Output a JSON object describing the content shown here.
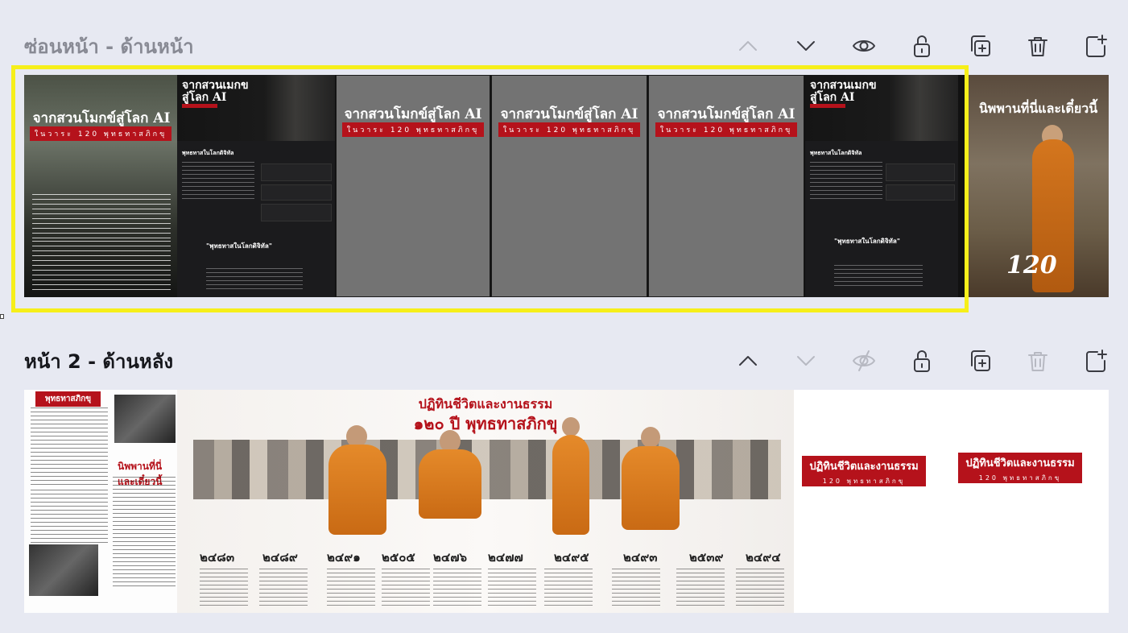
{
  "pages": [
    {
      "title": "ซ่อนหน้า - ด้านหน้า",
      "tools": [
        "chevron-up",
        "chevron-down",
        "eye",
        "lock",
        "duplicate",
        "trash",
        "add-page"
      ]
    },
    {
      "title": "หน้า 2 - ด้านหลัง",
      "tools": [
        "chevron-up",
        "chevron-down",
        "eye-off",
        "lock",
        "duplicate",
        "trash",
        "add-page"
      ]
    }
  ],
  "page1": {
    "poster_title": "จากสวนโมกข์สู่โลก AI",
    "poster_sub": "ในวาระ 120 พุทธทาสภิกขุ",
    "web_title": "จากสวนเมกข\nสู่โลก AI",
    "web_section": "พุทธทาสในโลกดิจิทัล",
    "web_quote": "\"พุทธทาสในโลกดิจิทัล\"",
    "monk_title": "นิพพานที่นี่และเดี๋ยวนี้",
    "monk_number": "120"
  },
  "page2": {
    "doc_tag": "พุทธทาสภิกขุ",
    "doc_title": "นิพพานที่นี่และเดี๋ยวนี้",
    "timeline_title": "ปฏิทินชีวิตและงานธรรม",
    "timeline_subtitle": "๑๒๐ ปี พุทธทาสภิกขุ",
    "years": [
      "๒๔๘๓",
      "๒๔๘๙",
      "๒๔๙๑",
      "๒๕๐๕",
      "๒๔๗๖",
      "๒๔๗๗",
      "๒๔๙๕",
      "๒๔๙๓",
      "๒๕๓๙",
      "๒๔๙๔"
    ],
    "label_title": "ปฏิทินชีวิตและงานธรรม",
    "label_sub": "120 พุทธทาสภิกขุ"
  },
  "colors": {
    "accent_red": "#b5121b",
    "selection": "#f6ef1a"
  }
}
